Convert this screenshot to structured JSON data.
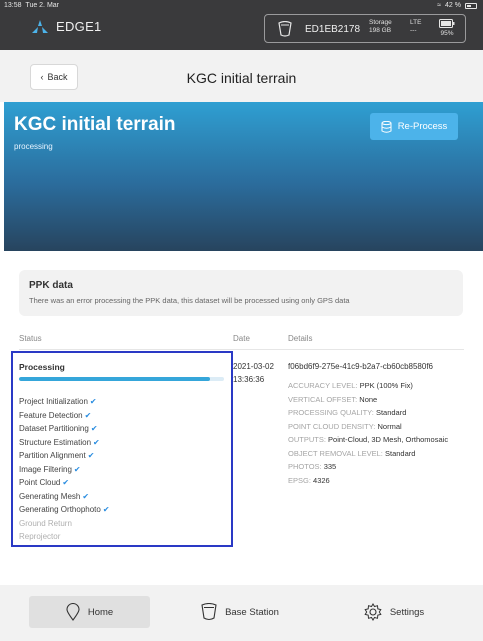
{
  "system": {
    "time": "13:58",
    "date": "Tue 2. Mar",
    "battery": "42 %"
  },
  "app": {
    "name": "EDGE1"
  },
  "device": {
    "id": "ED1EB2178",
    "storage_label": "Storage",
    "storage_value": "198 GB",
    "lte_label": "LTE",
    "lte_value": "---",
    "battery_percent": "95%"
  },
  "header": {
    "back_label": "Back",
    "title": "KGC initial terrain"
  },
  "hero": {
    "title": "KGC initial terrain",
    "status": "processing",
    "reprocess_label": "Re-Process"
  },
  "ppk": {
    "title": "PPK data",
    "message": "There was an error processing the PPK data, this dataset will be processed using only GPS data"
  },
  "table": {
    "status_header": "Status",
    "date_header": "Date",
    "details_header": "Details"
  },
  "processing": {
    "label": "Processing",
    "progress_percent": 93,
    "steps": [
      {
        "label": "Project Initialization",
        "done": true
      },
      {
        "label": "Feature Detection",
        "done": true
      },
      {
        "label": "Dataset Partitioning",
        "done": true
      },
      {
        "label": "Structure Estimation",
        "done": true
      },
      {
        "label": "Partition Alignment",
        "done": true
      },
      {
        "label": "Image Filtering",
        "done": true
      },
      {
        "label": "Point Cloud",
        "done": true
      },
      {
        "label": "Generating Mesh",
        "done": true
      },
      {
        "label": "Generating Orthophoto",
        "done": true
      },
      {
        "label": "Ground Return",
        "done": false
      },
      {
        "label": "Reprojector",
        "done": false
      }
    ]
  },
  "date": {
    "day": "2021-03-02",
    "time": "13:36:36"
  },
  "details": {
    "dataset_id": "f06bd6f9-275e-41c9-b2a7-cb60cb8580f6",
    "rows": [
      {
        "key": "ACCURACY LEVEL:",
        "value": "PPK (100% Fix)"
      },
      {
        "key": "VERTICAL OFFSET:",
        "value": "None"
      },
      {
        "key": "PROCESSING QUALITY:",
        "value": "Standard"
      },
      {
        "key": "POINT CLOUD DENSITY:",
        "value": "Normal"
      },
      {
        "key": "OUTPUTS:",
        "value": "Point-Cloud, 3D Mesh, Orthomosaic"
      },
      {
        "key": "OBJECT REMOVAL LEVEL:",
        "value": "Standard"
      },
      {
        "key": "PHOTOS:",
        "value": "335"
      },
      {
        "key": "EPSG:",
        "value": "4326"
      }
    ]
  },
  "nav": {
    "home": "Home",
    "base_station": "Base Station",
    "settings": "Settings"
  },
  "colors": {
    "accent": "#4cb3ea",
    "highlight_box": "#2a39c5",
    "check": "#2a8de0"
  }
}
